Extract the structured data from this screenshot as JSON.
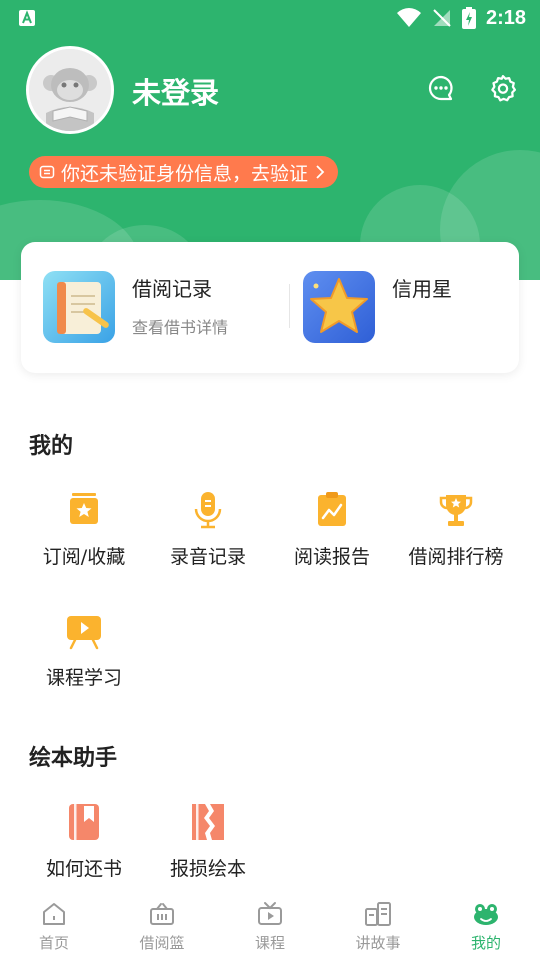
{
  "status_bar": {
    "time": "2:18"
  },
  "profile": {
    "username": "未登录",
    "verify_prompt": "你还未验证身份信息，去验证"
  },
  "quick_cards": [
    {
      "title": "借阅记录",
      "subtitle": "查看借书详情"
    },
    {
      "title": "信用星",
      "subtitle": ""
    }
  ],
  "sections": {
    "mine": {
      "title": "我的",
      "items": [
        {
          "label": "订阅/收藏",
          "icon": "bookmark-star-icon"
        },
        {
          "label": "录音记录",
          "icon": "microphone-icon"
        },
        {
          "label": "阅读报告",
          "icon": "report-chart-icon"
        },
        {
          "label": "借阅排行榜",
          "icon": "trophy-icon"
        },
        {
          "label": "课程学习",
          "icon": "video-board-icon"
        }
      ]
    },
    "helper": {
      "title": "绘本助手",
      "items": [
        {
          "label": "如何还书",
          "icon": "book-return-icon"
        },
        {
          "label": "报损绘本",
          "icon": "damaged-book-icon"
        }
      ]
    }
  },
  "tabbar": [
    {
      "label": "首页",
      "icon": "home-icon",
      "active": false
    },
    {
      "label": "借阅篮",
      "icon": "basket-icon",
      "active": false
    },
    {
      "label": "课程",
      "icon": "tv-icon",
      "active": false
    },
    {
      "label": "讲故事",
      "icon": "books-icon",
      "active": false
    },
    {
      "label": "我的",
      "icon": "frog-icon",
      "active": true
    }
  ],
  "colors": {
    "brand_green": "#2db46e",
    "accent_orange": "#ff7a4d",
    "icon_yellow": "#fbb32e",
    "icon_coral": "#f5876a"
  }
}
